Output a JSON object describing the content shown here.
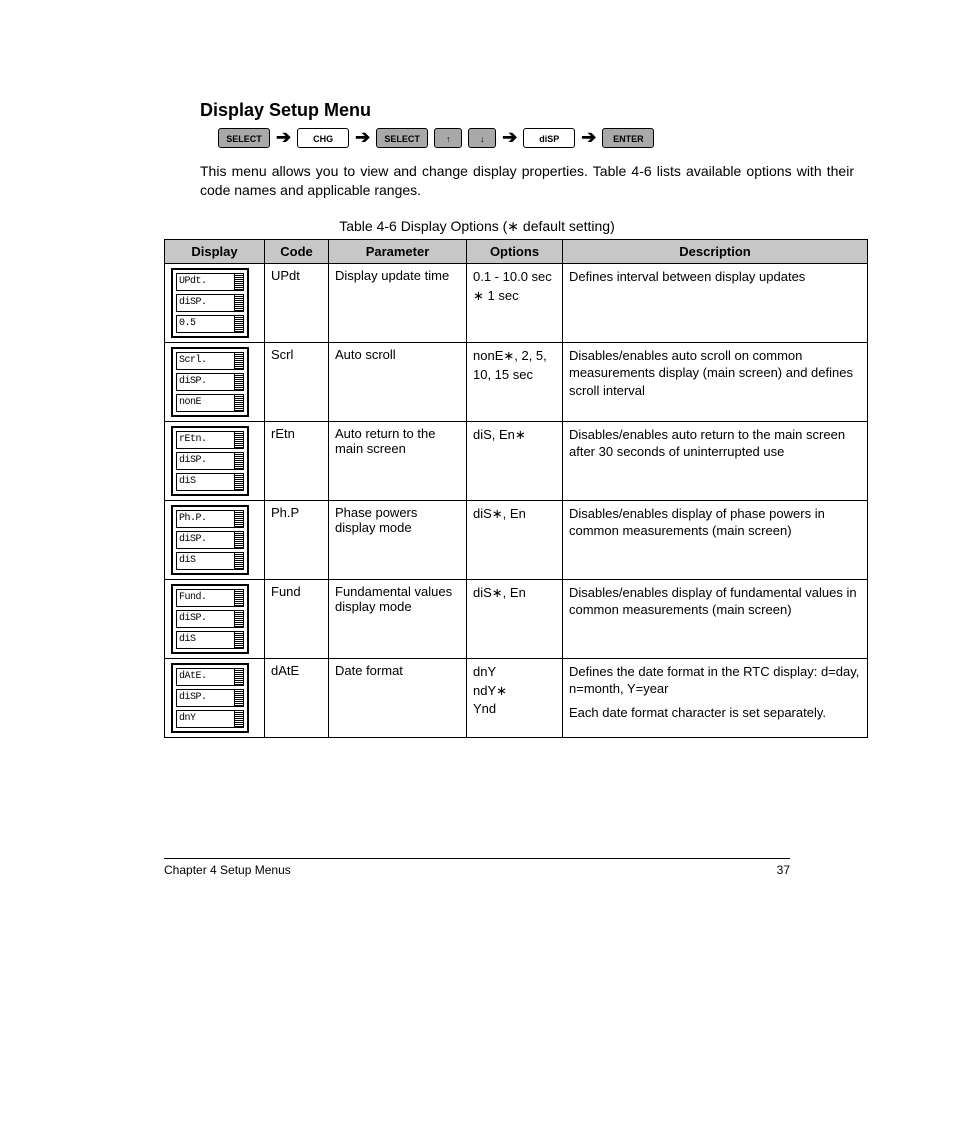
{
  "heading": "Display Setup Menu",
  "breadcrumb": {
    "b1": "SELECT",
    "b2": "CHG",
    "b3": "SELECT",
    "b4": "diSP",
    "b5": "ENTER",
    "up": "↑",
    "down": "↓"
  },
  "intro": "This menu allows you to view and change display properties. Table 4-6 lists available options with their code names and applicable ranges.",
  "table_caption_prefix": "Table 4-6  Display Options ",
  "table_caption_suffix": "(∗ default setting)",
  "columns": {
    "display": "Display",
    "code": "Code",
    "parameter": "Parameter",
    "options": "Options",
    "description": "Description"
  },
  "rows": [
    {
      "lcd": [
        "UPdt.",
        "diSP.",
        "0.5"
      ],
      "code": "UPdt",
      "parameter": "Display update time",
      "options": "0.1 - 10.0 sec\n∗ 1 sec",
      "description": [
        "Defines interval between display updates"
      ]
    },
    {
      "lcd": [
        "Scrl.",
        "diSP.",
        "nonE"
      ],
      "code": "Scrl",
      "parameter": "Auto scroll",
      "options": "nonE∗, 2, 5, 10, 15 sec",
      "description": [
        "Disables/enables auto scroll on common measurements display (main screen) and defines scroll interval"
      ]
    },
    {
      "lcd": [
        "rEtn.",
        "diSP.",
        "diS"
      ],
      "code": "rEtn",
      "parameter": "Auto return to the main screen",
      "options": "diS, En∗",
      "description": [
        "Disables/enables auto return to the main screen after 30 seconds of uninterrupted use"
      ]
    },
    {
      "lcd": [
        "Ph.P.",
        "diSP.",
        "diS"
      ],
      "code": "Ph.P",
      "parameter": "Phase powers display mode",
      "options": "diS∗, En",
      "description": [
        "Disables/enables display of phase powers in common measurements (main screen)"
      ]
    },
    {
      "lcd": [
        "Fund.",
        "diSP.",
        "diS"
      ],
      "code": "Fund",
      "parameter": "Fundamental values display mode",
      "options": "diS∗, En",
      "description": [
        "Disables/enables display of fundamental values in common measurements (main screen)"
      ]
    },
    {
      "lcd": [
        "dAtE.",
        "diSP.",
        "dnY"
      ],
      "code": "dAtE",
      "parameter": "Date format",
      "options": "dnY\nndY∗\nYnd",
      "description": [
        "Defines the date format in the RTC display: d=day, n=month, Y=year",
        "Each date format character is set separately."
      ]
    }
  ],
  "footer": {
    "left": "Chapter 4  Setup Menus",
    "right": "37"
  }
}
